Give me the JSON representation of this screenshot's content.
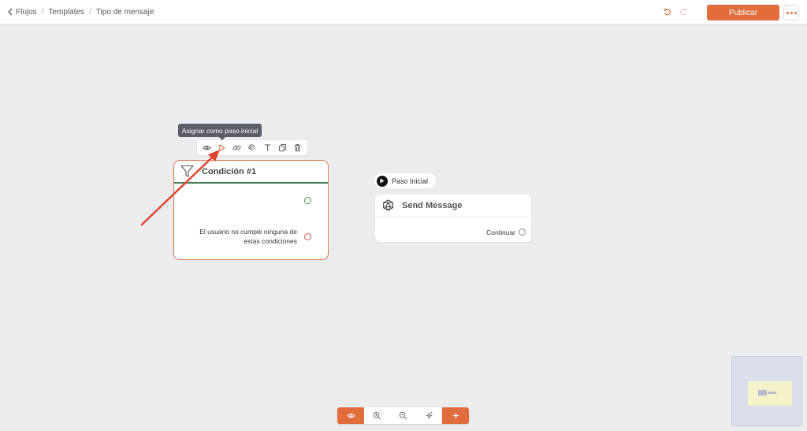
{
  "breadcrumb": {
    "items": [
      "Flujos",
      "Templates",
      "Tipo de mensaje"
    ],
    "separator": "/"
  },
  "header": {
    "publish_label": "Publicar"
  },
  "tooltip": {
    "text": "Asignar como paso inicial"
  },
  "toolbar_icons": [
    "eye-icon",
    "play-icon",
    "link-icon",
    "fingerprint-icon",
    "text-icon",
    "copy-icon",
    "trash-icon"
  ],
  "condition_node": {
    "title": "Condición #1",
    "else_line1": "El usuario no cumple ninguna de",
    "else_line2": "estas condiciones"
  },
  "start_badge": {
    "label": "Paso Inicial"
  },
  "send_node": {
    "title": "Send Message",
    "continue_label": "Continuar"
  },
  "zoom_controls": [
    "eye-icon",
    "zoom-in-icon",
    "zoom-out-icon",
    "fit-view-icon",
    "add-icon"
  ],
  "colors": {
    "accent": "#e06d3b",
    "success": "#3f9a4b",
    "danger": "#d9534f",
    "arrow": "#e0462f"
  }
}
